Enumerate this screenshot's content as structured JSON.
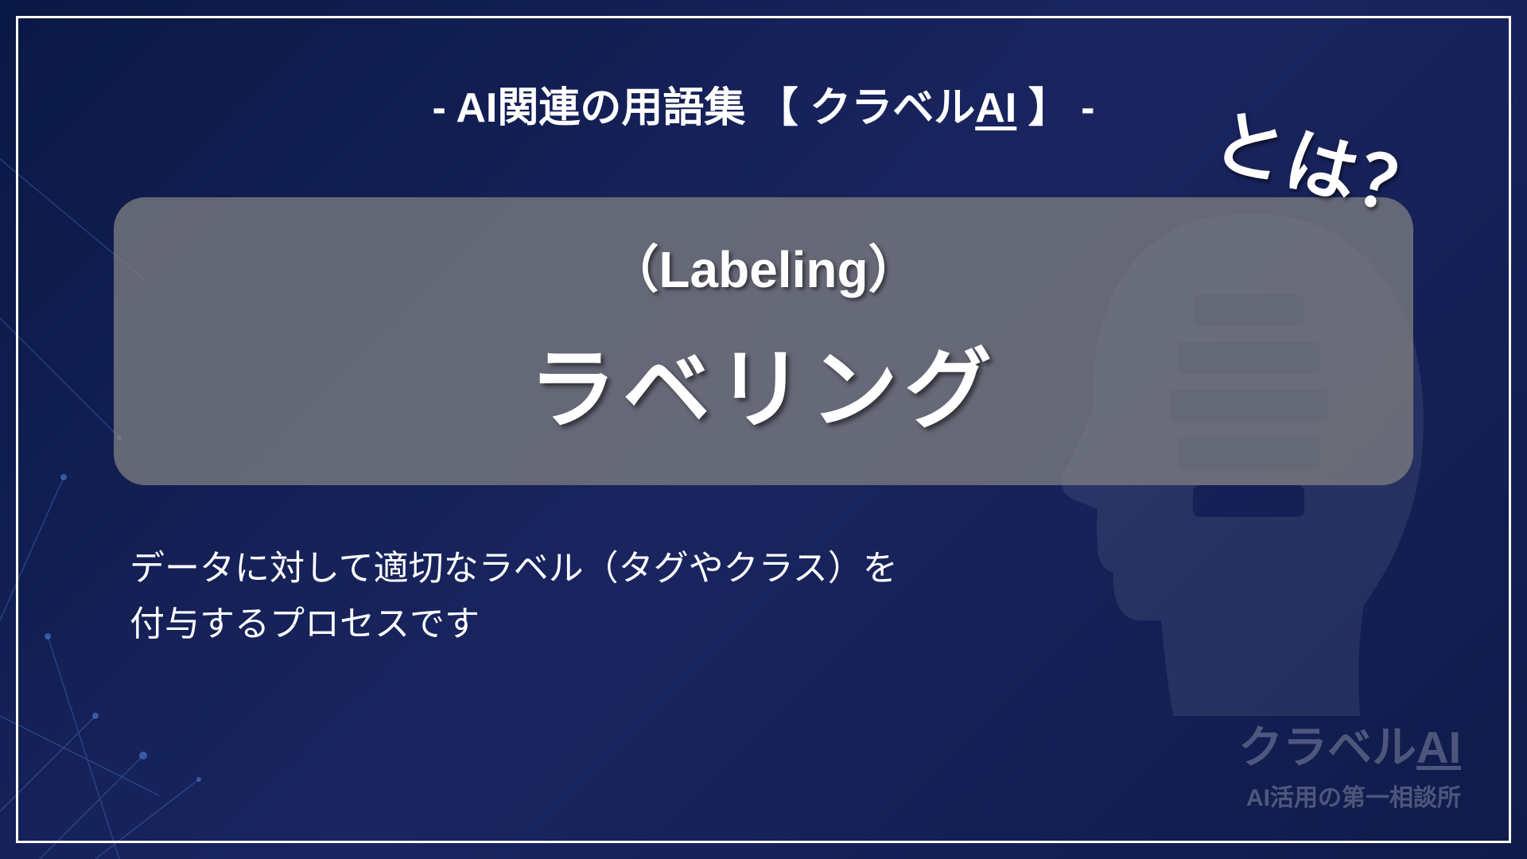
{
  "header": {
    "prefix": "- AI関連の用語集 【 クラベル",
    "ai_text": "AI",
    "suffix": " 】 -"
  },
  "term": {
    "english": "（Labeling）",
    "japanese": "ラベリング",
    "towa": "とは？"
  },
  "description": {
    "line1": "データに対して適切なラベル（タグやクラス）を",
    "line2": "付与するプロセスです"
  },
  "footer": {
    "brand_prefix": "クラベル",
    "brand_ai": "AI",
    "tagline": "AI活用の第一相談所"
  }
}
